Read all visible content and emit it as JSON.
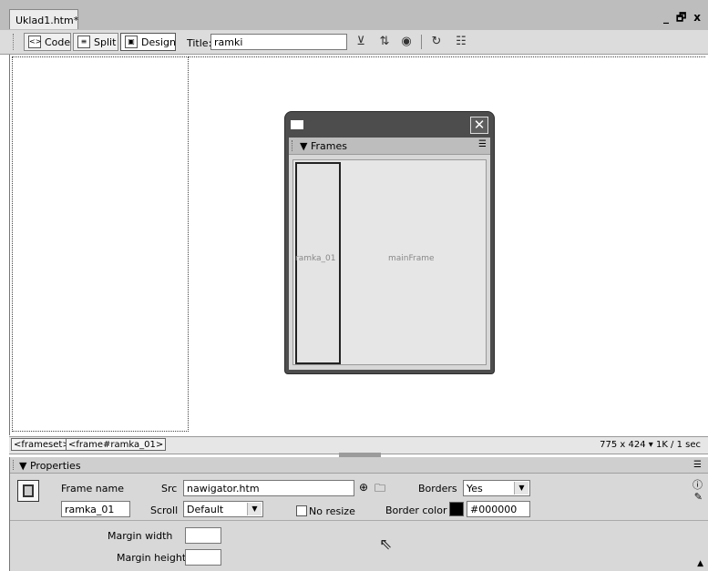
{
  "document": {
    "tab_label": "Uklad1.htm*",
    "window_controls": [
      "_",
      "🗗",
      "x"
    ]
  },
  "toolbar": {
    "code_label": "Code",
    "split_label": "Split",
    "design_label": "Design",
    "title_label": "Title:",
    "title_value": "ramki",
    "icons": [
      "validate-icon",
      "file-management-icon",
      "preview-browser-icon",
      "refresh-icon",
      "view-options-icon"
    ]
  },
  "frames_panel": {
    "title": "Frames",
    "frame_left_name": "ramka_01",
    "frame_main_name": "mainFrame"
  },
  "status_bar": {
    "tags": [
      "<frameset>",
      "<frame#ramka_01>"
    ],
    "info": "775 x 424 ▾ 1K / 1 sec"
  },
  "properties": {
    "title": "Properties",
    "frame_name_label": "Frame name",
    "frame_name_value": "ramka_01",
    "src_label": "Src",
    "src_value": "nawigator.htm",
    "borders_label": "Borders",
    "borders_value": "Yes",
    "scroll_label": "Scroll",
    "scroll_value": "Default",
    "no_resize_label": "No resize",
    "border_color_label": "Border color",
    "border_color_value": "#000000",
    "margin_width_label": "Margin width",
    "margin_width_value": "",
    "margin_height_label": "Margin height",
    "margin_height_value": ""
  }
}
